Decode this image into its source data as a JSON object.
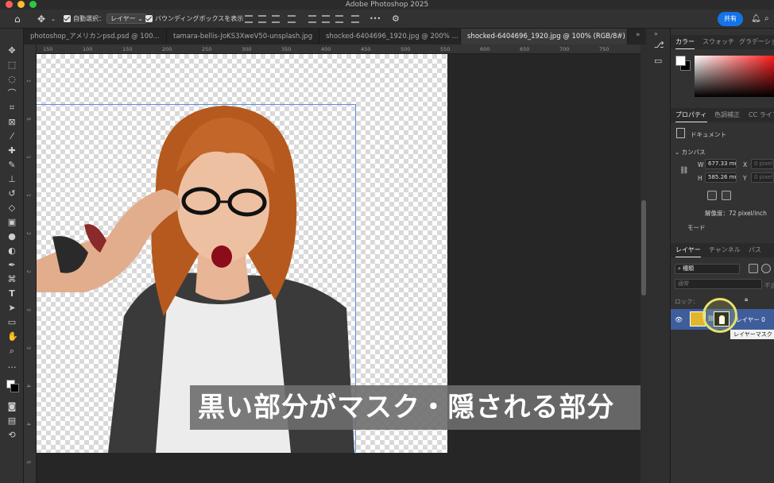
{
  "app": {
    "title": "Adobe Photoshop 2025"
  },
  "options_bar": {
    "auto_select_label": "自動選択：",
    "auto_select_value": "レイヤー",
    "bbox_label": "バウンディングボックスを表示",
    "more": "•••",
    "share_label": "共有"
  },
  "tabs": [
    {
      "label": "photoshop_アメリカンpsd.psd @ 100...",
      "active": false
    },
    {
      "label": "tamara-bellis-JoKS3XweV50-unsplash.jpg",
      "active": false
    },
    {
      "label": "shocked-6404696_1920.jpg @ 200% ...",
      "active": false
    },
    {
      "label": "shocked-6404696_1920.jpg @ 100% (RGB/8#) *",
      "active": true
    }
  ],
  "rulers": {
    "top_marks": [
      "150",
      "100",
      "150",
      "200",
      "250",
      "300",
      "350",
      "400",
      "450",
      "500",
      "550",
      "600",
      "650",
      "700",
      "750"
    ],
    "left_marks": [
      "1",
      "5",
      "1",
      "1",
      "2",
      "2",
      "3",
      "3",
      "4",
      "4",
      "5"
    ]
  },
  "canvas": {
    "subtitle": "黒い部分がマスク・隠される部分"
  },
  "color_panel": {
    "tabs": [
      "カラー",
      "スウォッチ",
      "グラデーション"
    ]
  },
  "properties_panel": {
    "tabs": [
      "プロパティ",
      "色調補正",
      "CC ライブ"
    ],
    "document_label": "ドキュメント",
    "canvas_section": "カンバス",
    "width_label": "W",
    "width_value": "677.33 mm",
    "height_label": "H",
    "height_value": "585.26 mm",
    "x_label": "X",
    "x_value": "0 pixel",
    "y_label": "Y",
    "y_value": "0 pixel",
    "resolution": "解像度：72 pixel/inch",
    "mode_label": "モード"
  },
  "layers_panel": {
    "tabs": [
      "レイヤー",
      "チャンネル",
      "パス"
    ],
    "filter_kind": "種類",
    "blend_mode": "通常",
    "opacity_label": "不透",
    "lock_label": "ロック：",
    "layer_name": "レイヤー 0",
    "tooltip": "レイヤーマスク"
  },
  "colors": {
    "accent": "#1473e6",
    "selected_layer": "#3e5d9a",
    "guide": "#5d8fe0",
    "cursor_highlight": "#e8e26a"
  }
}
